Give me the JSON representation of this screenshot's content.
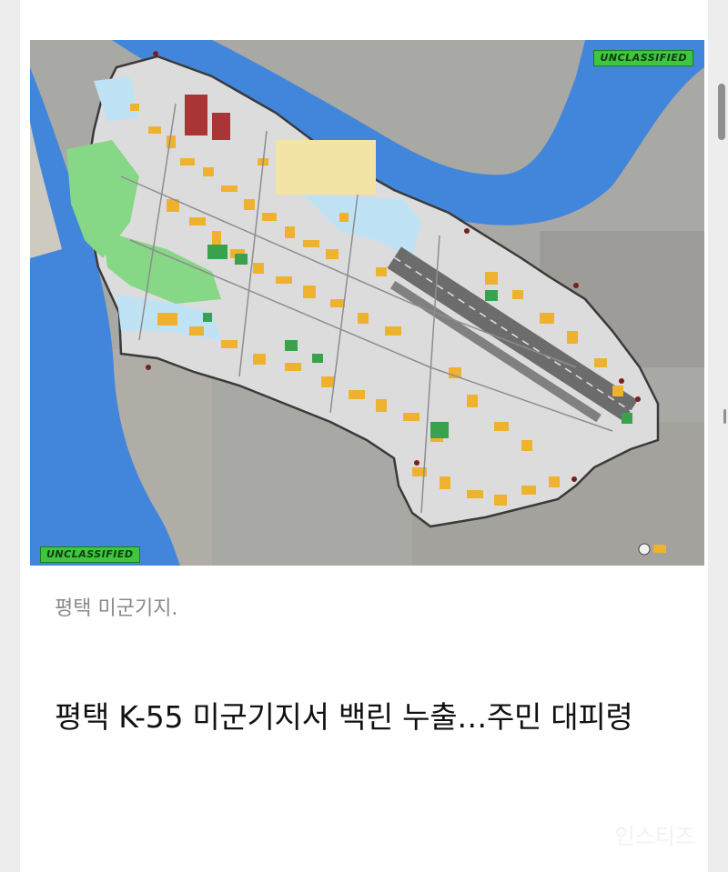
{
  "article": {
    "image_alt": "평택 미군기지 지도",
    "badge_top": "UNCLASSIFIED",
    "badge_bottom": "UNCLASSIFIED",
    "caption": "평택 미군기지.",
    "headline": "평택 K-55 미군기지서 백린 누출…주민 대피령",
    "watermark": "인스티즈"
  },
  "colors": {
    "river": "#3f7fdc",
    "base_outline": "#3a3a3a",
    "building": "#efb22f",
    "green_area": "#7bd17b",
    "runway": "#6c6c6c",
    "badge": "#3ec63e"
  }
}
